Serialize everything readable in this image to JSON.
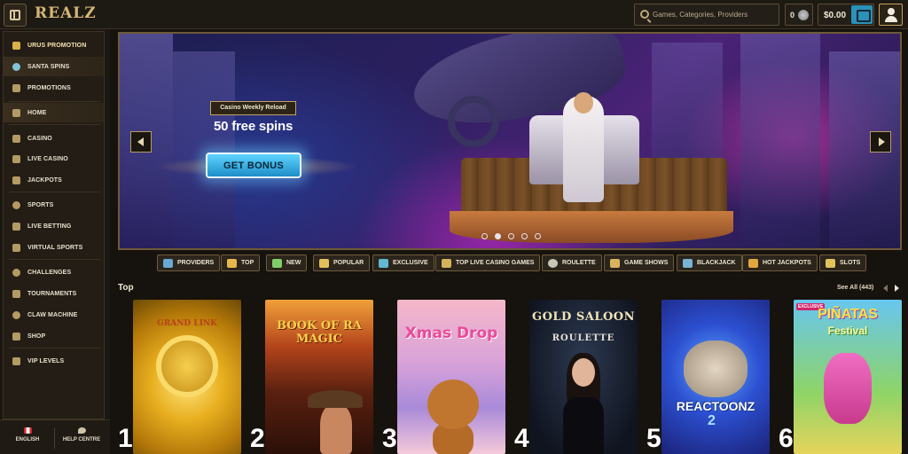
{
  "app": {
    "logo_text": "REALZ"
  },
  "header": {
    "search_placeholder": "Games, Categories, Providers",
    "coins_count": "0",
    "balance": "$0.00"
  },
  "sidebar": {
    "items": [
      {
        "label": "URUS PROMOTION",
        "icon": "car-icon"
      },
      {
        "label": "SANTA SPINS",
        "icon": "snowglobe-icon"
      },
      {
        "label": "PROMOTIONS",
        "icon": "gift-icon"
      },
      {
        "label": "HOME",
        "icon": "home-icon"
      },
      {
        "label": "CASINO",
        "icon": "slot-machine-icon"
      },
      {
        "label": "LIVE CASINO",
        "icon": "cards-icon"
      },
      {
        "label": "JACKPOTS",
        "icon": "jackpot-icon"
      },
      {
        "label": "SPORTS",
        "icon": "ball-icon"
      },
      {
        "label": "LIVE BETTING",
        "icon": "live-icon"
      },
      {
        "label": "VIRTUAL SPORTS",
        "icon": "virtual-icon"
      },
      {
        "label": "CHALLENGES",
        "icon": "trophy-icon"
      },
      {
        "label": "TOURNAMENTS",
        "icon": "tournament-icon"
      },
      {
        "label": "CLAW MACHINE",
        "icon": "claw-icon"
      },
      {
        "label": "SHOP",
        "icon": "shop-icon"
      },
      {
        "label": "VIP LEVELS",
        "icon": "vip-icon"
      }
    ],
    "footer": {
      "language": "ENGLISH",
      "help": "HELP CENTRE"
    }
  },
  "banner": {
    "tag": "Casino Weekly Reload",
    "title": "50 free spins",
    "cta": "GET BONUS",
    "slides": 5,
    "active_slide": 2
  },
  "categories": [
    {
      "label": "PROVIDERS",
      "color": "#6aa7d6"
    },
    {
      "label": "TOP",
      "color": "#e6b84a"
    },
    {
      "label": "NEW",
      "color": "#7fce6a"
    },
    {
      "label": "POPULAR",
      "color": "#e3c05b"
    },
    {
      "label": "EXCLUSIVE",
      "color": "#61b9d3"
    },
    {
      "label": "TOP LIVE CASINO GAMES",
      "color": "#d8b25a"
    },
    {
      "label": "ROULETTE",
      "color": "#c7c7b3"
    },
    {
      "label": "GAME SHOWS",
      "color": "#d9b45e"
    },
    {
      "label": "BLACKJACK",
      "color": "#78b4d3"
    },
    {
      "label": "HOT JACKPOTS",
      "color": "#e1a83f"
    },
    {
      "label": "SLOTS",
      "color": "#e2c25b"
    }
  ],
  "top_section": {
    "title": "Top",
    "see_all": "See All (443)",
    "games": [
      {
        "rank": "1",
        "title": "GRAND LINK"
      },
      {
        "rank": "2",
        "title": "BOOK OF RA MAGIC"
      },
      {
        "rank": "3",
        "title": "Xmas Drop"
      },
      {
        "rank": "4",
        "title": "GOLD SALOON",
        "subtitle": "ROULETTE"
      },
      {
        "rank": "5",
        "title": "REACTOONZ",
        "subtitle": "2"
      },
      {
        "rank": "6",
        "title": "PIÑATAS",
        "subtitle": "Festival",
        "badge": "EXCLUSIVE"
      }
    ]
  }
}
